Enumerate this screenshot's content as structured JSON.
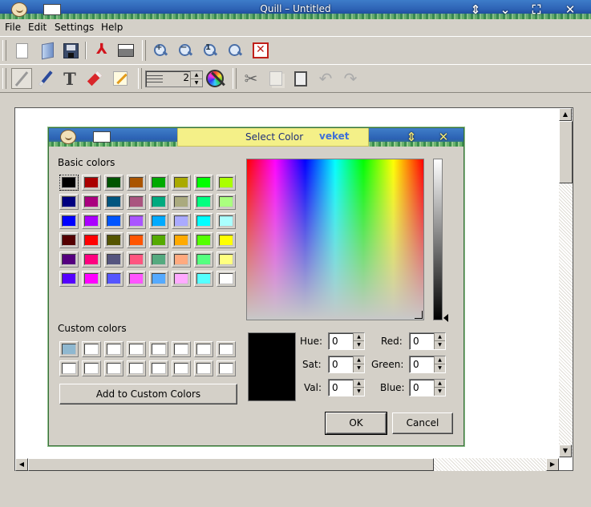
{
  "app": {
    "title": "Quill – Untitled"
  },
  "menu": [
    "File",
    "Edit",
    "Settings",
    "Help"
  ],
  "toolbar": {
    "line_width": "2"
  },
  "dialog": {
    "title": "Select Color",
    "tag": "veket",
    "basic_colors_label": "Basic colors",
    "custom_colors_label": "Custom colors",
    "add_button": "Add to Custom Colors",
    "ok_button": "OK",
    "cancel_button": "Cancel",
    "basic_colors": [
      [
        "#000000",
        "#aa0000",
        "#005500",
        "#aa5500",
        "#00aa00",
        "#aaaa00",
        "#00ff00",
        "#aaff00"
      ],
      [
        "#00007f",
        "#aa007f",
        "#00557f",
        "#aa557f",
        "#00aa7f",
        "#aaaa7f",
        "#00ff7f",
        "#aaff7f"
      ],
      [
        "#0000ff",
        "#aa00ff",
        "#0055ff",
        "#aa55ff",
        "#00aaff",
        "#aaaaff",
        "#00ffff",
        "#aaffff"
      ],
      [
        "#550000",
        "#ff0000",
        "#555500",
        "#ff5500",
        "#55aa00",
        "#ffaa00",
        "#55ff00",
        "#ffff00"
      ],
      [
        "#55007f",
        "#ff007f",
        "#55557f",
        "#ff557f",
        "#55aa7f",
        "#ffaa7f",
        "#55ff7f",
        "#ffff7f"
      ],
      [
        "#5500ff",
        "#ff00ff",
        "#5555ff",
        "#ff55ff",
        "#55aaff",
        "#ffaaff",
        "#55ffff",
        "#ffffff"
      ]
    ],
    "custom_colors": [
      [
        "#8fb8d0",
        "#ffffff",
        "#ffffff",
        "#ffffff",
        "#ffffff",
        "#ffffff",
        "#ffffff",
        "#ffffff"
      ],
      [
        "#ffffff",
        "#ffffff",
        "#ffffff",
        "#ffffff",
        "#ffffff",
        "#ffffff",
        "#ffffff",
        "#ffffff"
      ]
    ],
    "fields": {
      "hue": {
        "label": "Hue:",
        "value": "0"
      },
      "sat": {
        "label": "Sat:",
        "value": "0"
      },
      "val": {
        "label": "Val:",
        "value": "0"
      },
      "red": {
        "label": "Red:",
        "value": "0"
      },
      "green": {
        "label": "Green:",
        "value": "0"
      },
      "blue": {
        "label": "Blue:",
        "value": "0"
      }
    },
    "current_color": "#000000"
  }
}
